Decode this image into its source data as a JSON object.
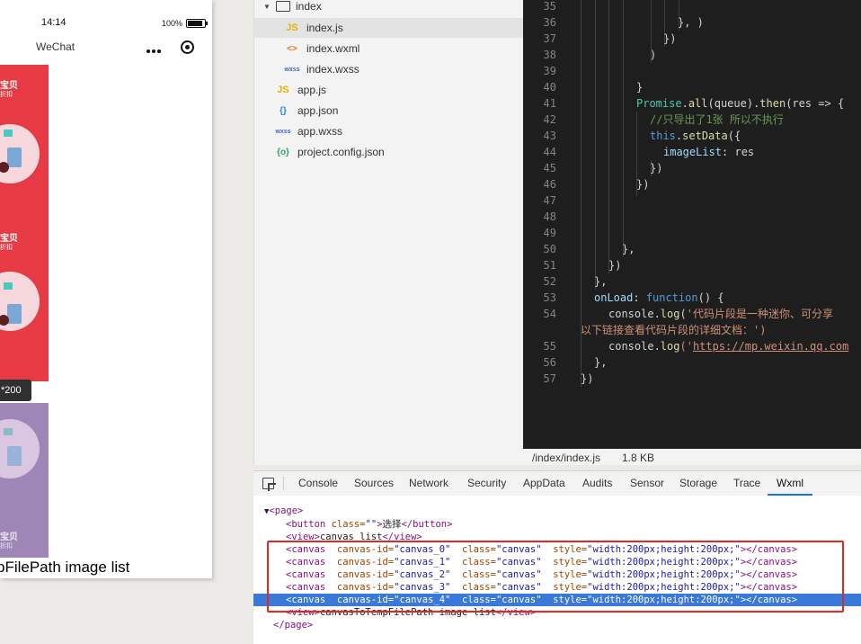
{
  "simulator": {
    "time": "14:14",
    "battery": "100%",
    "nav_title": "WeChat",
    "banner_text_1": "宝贝",
    "banner_text_2": "折扣",
    "tooltip": "*200",
    "caption": "pFilePath image list"
  },
  "file_tree": {
    "folder": "index",
    "items": [
      {
        "name": "index.js",
        "icon": "JS"
      },
      {
        "name": "index.wxml",
        "icon": "<>"
      },
      {
        "name": "index.wxss",
        "icon": "wxss"
      },
      {
        "name": "app.js",
        "icon": "JS"
      },
      {
        "name": "app.json",
        "icon": "{}"
      },
      {
        "name": "app.wxss",
        "icon": "wxss"
      },
      {
        "name": "project.config.json",
        "icon": "{o}"
      }
    ]
  },
  "editor": {
    "lines": [
      {
        "num": "35"
      },
      {
        "num": "36",
        "code": "}, )"
      },
      {
        "num": "37",
        "code": "})"
      },
      {
        "num": "38",
        "code": ")"
      },
      {
        "num": "39"
      },
      {
        "num": "40",
        "code": "}"
      },
      {
        "num": "41",
        "t1": "Promise",
        "t2": ".",
        "t3": "all",
        "t4": "(queue).",
        "t5": "then",
        "t6": "(res => {"
      },
      {
        "num": "42",
        "comment": "//只导出了1张 所以不执行"
      },
      {
        "num": "43",
        "t1": "this",
        "t2": ".",
        "t3": "setData",
        "t4": "({"
      },
      {
        "num": "44",
        "prop": "imageList",
        "rest": ": res"
      },
      {
        "num": "45",
        "code": "})"
      },
      {
        "num": "46",
        "code": "})"
      },
      {
        "num": "47"
      },
      {
        "num": "48"
      },
      {
        "num": "49"
      },
      {
        "num": "50",
        "code": "},"
      },
      {
        "num": "51",
        "code": "})"
      },
      {
        "num": "52",
        "code": "},"
      },
      {
        "num": "53",
        "prop": "onLoad",
        "mid": ": ",
        "kw": "function",
        "rest": "() {"
      },
      {
        "num": "54",
        "pre": "console.",
        "fn": "log",
        "open": "(",
        "str": "'代码片段是一种迷你、可分享"
      },
      {
        "num": "",
        "str": "以下链接查看代码片段的详细文档：')"
      },
      {
        "num": "55",
        "pre": "console.",
        "fn": "log",
        "open": "('",
        "link": "https://mp.weixin.qq.com"
      },
      {
        "num": "56",
        "code": "},"
      },
      {
        "num": "57",
        "code": "})"
      }
    ],
    "status_path": "/index/index.js",
    "status_size": "1.8 KB"
  },
  "devtools": {
    "tabs": [
      "Console",
      "Sources",
      "Network",
      "Security",
      "AppData",
      "Audits",
      "Sensor",
      "Storage",
      "Trace",
      "Wxml"
    ],
    "active_tab": "Wxml",
    "wxml": {
      "page_open": "<page>",
      "button": {
        "tag_open": "<button",
        "attr": "class=",
        "val": "\"\"",
        "close": ">",
        "text": "选择",
        "end": "</button>"
      },
      "view1": {
        "open": "<view>",
        "text": "canvas list",
        "close": "</view>"
      },
      "canvases": [
        {
          "id": "\"canvas_0\""
        },
        {
          "id": "\"canvas_1\""
        },
        {
          "id": "\"canvas_2\""
        },
        {
          "id": "\"canvas_3\""
        },
        {
          "id": "\"canvas_4\""
        }
      ],
      "canvas_tag": "<canvas",
      "canvas_id_attr": "canvas-id=",
      "class_attr": "class=",
      "class_val": "\"canvas\"",
      "style_attr": "style=",
      "style_val": "\"width:200px;height:200px;\"",
      "canvas_close": "></canvas>",
      "view2": {
        "open": "<view>",
        "text": "canvasToTempFilePath image list",
        "close": "</view>"
      },
      "page_close": "</page>"
    }
  },
  "colors": {
    "banner_red": "#e63b44",
    "banner_purple": "#9e87b6",
    "selection": "#3879d9",
    "highlight_box": "#e32626"
  }
}
